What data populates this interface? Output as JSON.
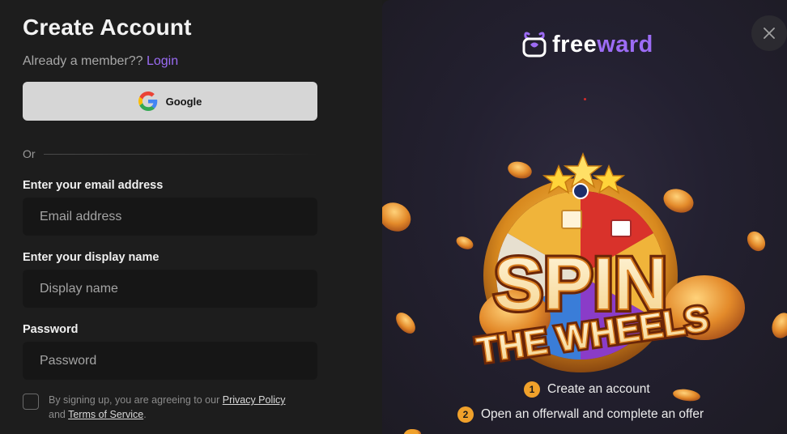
{
  "form": {
    "title": "Create Account",
    "member_text": "Already a member??",
    "login_link": "Login",
    "google_label": "Google",
    "or_text": "Or",
    "email_label": "Enter your email address",
    "email_placeholder": "Email address",
    "display_label": "Enter your display name",
    "display_placeholder": "Display name",
    "password_label": "Password",
    "password_placeholder": "Password",
    "terms_prefix": "By signing up, you are agreeing to our",
    "privacy_link": "Privacy Policy",
    "terms_and": "and",
    "terms_link": "Terms of Service",
    "terms_suffix": "."
  },
  "promo": {
    "logo_main": "free",
    "logo_accent": "ward",
    "headline_top": "SPIN",
    "headline_bottom": "THE WHEELS",
    "steps": [
      {
        "num": "1",
        "text": "Create an account"
      },
      {
        "num": "2",
        "text": "Open an offerwall and complete an offer"
      }
    ]
  },
  "close_icon": "close-icon",
  "colors": {
    "accent": "#9b6cf4",
    "step_badge": "#f0a12b",
    "google_btn": "#d6d6d6"
  }
}
